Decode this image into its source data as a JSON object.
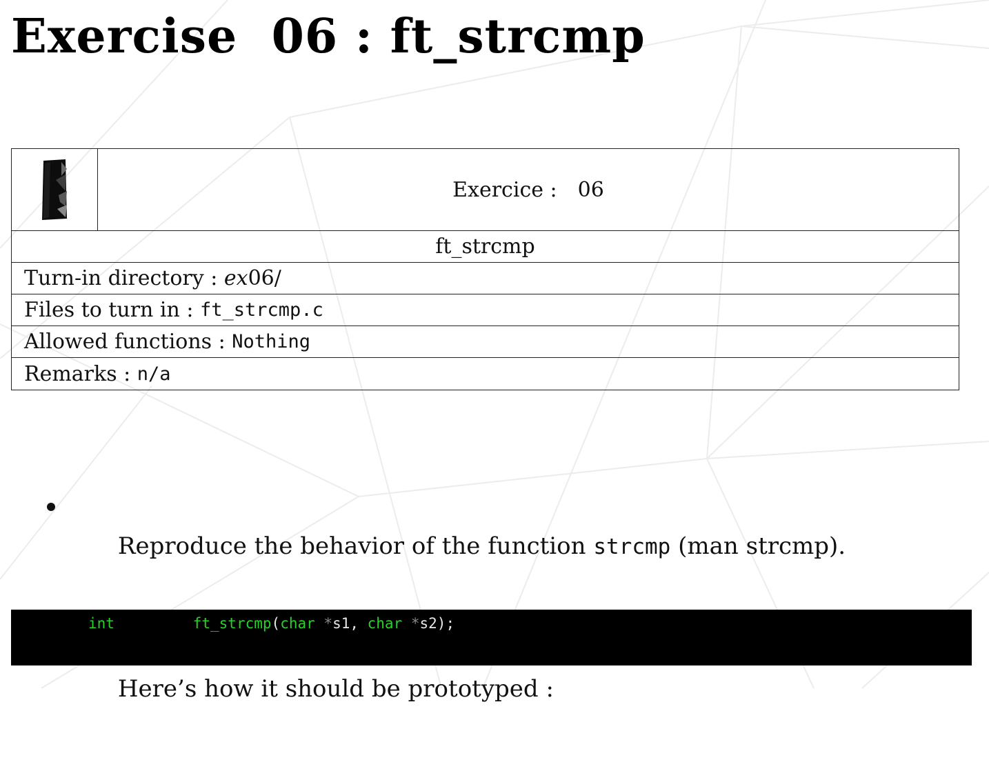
{
  "title": "Exercise  06 : ft_strcmp",
  "header": {
    "exercise_label": "Exercice :",
    "exercise_number": "06",
    "exercise_name": "ft_strcmp"
  },
  "info": {
    "turnin_label": "Turn-in directory : ",
    "turnin_prefix": "ex",
    "turnin_value": "06/",
    "files_label": "Files to turn in : ",
    "files_value": "ft_strcmp.c",
    "allowed_label": "Allowed functions : ",
    "allowed_value": "Nothing",
    "remarks_label": "Remarks : ",
    "remarks_value": "n/a"
  },
  "bullets": {
    "b1_pre": "Reproduce the behavior of the function ",
    "b1_code": "strcmp",
    "b1_post": " (man strcmp).",
    "b2": "Here’s how it should be prototyped :"
  },
  "code": {
    "type": "int",
    "spacing": "         ",
    "func": "ft_strcmp",
    "open": "(",
    "t1": "char",
    "star1": " *",
    "a1": "s1, ",
    "t2": "char",
    "star2": " *",
    "a2": "s2);"
  }
}
